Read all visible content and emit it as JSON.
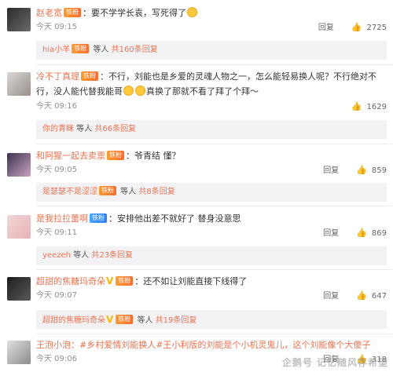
{
  "comments": [
    {
      "user": "赵老宽",
      "badge": "铁粉",
      "text": "：要不学学长袁，写死得了",
      "time": "今天 09:15",
      "reply_label": "回复",
      "likes": "2725",
      "sub": {
        "user": "hia小羊",
        "suffix": " 等人 ",
        "count": "共160条回复",
        "badge": "铁粉"
      }
    },
    {
      "user": "冷不丁真理",
      "badge": "铁粉",
      "text": "：不行，刘能也是乡爱的灵魂人物之一，怎么能轻易换人呢？不行绝对不行，没人能代替我能哥",
      "text2": "真换了那就不看了拜了个拜～",
      "time": "今天 09:16",
      "reply_label": "回复",
      "likes": "1629",
      "sub": {
        "user": "你的青眯",
        "suffix": " 等人 ",
        "count": "共66条回复"
      }
    },
    {
      "user": "和阿猩一起去卖票",
      "badge": "铁粉",
      "text": "：爷青结 懂？",
      "time": "今天 09:05",
      "reply_label": "回复",
      "likes": "859",
      "sub": {
        "user": "是瑟瑟不是涩涩",
        "suffix": " 等人 ",
        "count": "共8条回复",
        "badge": "铁粉"
      }
    },
    {
      "user": "是我拉拉蕾啊",
      "badge": "铁粉",
      "text": "：安排他出差不就好了 替身没意思",
      "time": "今天 09:11",
      "reply_label": "回复",
      "likes": "869",
      "sub": {
        "user": "yeezeh",
        "suffix": " 等人 ",
        "count": "共23条回复"
      }
    },
    {
      "user": "超甜的焦糖玛奇朵",
      "badge": "铁粉",
      "text": "：还不如让刘能直接下线得了",
      "time": "今天 09:07",
      "reply_label": "回复",
      "likes": "647",
      "sub": {
        "user": "超甜的焦糖玛奇朵",
        "suffix": " 等人 ",
        "count": "共19条回复",
        "badge": "铁粉"
      }
    },
    {
      "user": "王泡小泡",
      "text": "：#乡村爱情刘能换人#王小利版的刘能是个小机灵鬼儿，这个刘能像个大傻子",
      "time": "今天 09:06",
      "reply_label": "回复",
      "likes": "318"
    }
  ],
  "watermark": "企鹅号 记忆随风存希望",
  "colors": {
    "accent": "#eb7350",
    "sub_bg": "#f2f2f5"
  }
}
